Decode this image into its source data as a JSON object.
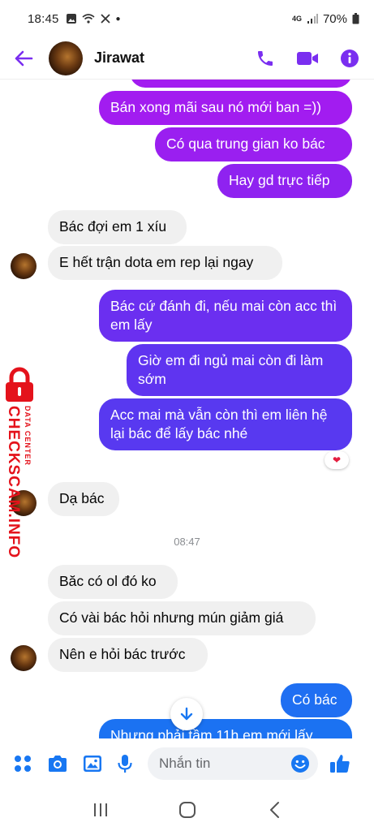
{
  "status_bar": {
    "time": "18:45",
    "network": "4G",
    "battery": "70%"
  },
  "header": {
    "contact_name": "Jirawat"
  },
  "colors": {
    "accent": "#7a2ef0",
    "out_top": "#a21cf0",
    "out_mid": "#6b2ff0",
    "out_bottom": "#1f6ff2",
    "incoming": "#f0f0f0"
  },
  "messages": {
    "m1": "Bán xong mãi sau nó mới ban =))",
    "m2": "Có qua trung gian ko bác",
    "m3": "Hay gd trực tiếp",
    "m4": "Bác đợi em 1 xíu",
    "m5": "E hết trận dota em rep lại ngay",
    "m6": "Bác cứ đánh đi, nếu mai còn acc thì em lấy",
    "m7": "Giờ em đi ngủ mai còn đi làm sớm",
    "m8": "Acc mai mà vẫn còn thì em liên hệ lại bác để lấy bác nhé",
    "m9": "Dạ bác",
    "time_divider": "08:47",
    "m10": "Băc có ol đó ko",
    "m11": "Có vài bác hỏi nhưng mún giảm giá",
    "m12": "Nên e hỏi bác trước",
    "m13": "Có bác",
    "m14": "Nhưng phải tầm 11h em mới lấy"
  },
  "reaction": "heart",
  "watermark": {
    "main": "CHECKSCAM.INFO",
    "sub": "DATA CENTER"
  },
  "composer": {
    "placeholder": "Nhắn tin"
  }
}
